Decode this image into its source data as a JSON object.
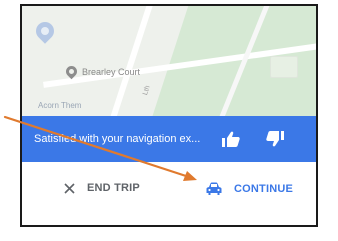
{
  "map": {
    "place_label": "Brearley Court",
    "street_label_1": "Acorn Them",
    "street_label_2": "Lth"
  },
  "feedback_banner": {
    "text": "Satisfied with your navigation ex...",
    "thumbs_up_icon": "thumbs-up-icon",
    "thumbs_down_icon": "thumbs-down-icon"
  },
  "actions": {
    "end_trip_label": "END TRIP",
    "end_trip_icon": "close-icon",
    "continue_label": "CONTINUE",
    "continue_icon": "car-icon"
  },
  "colors": {
    "accent_blue": "#3b78e7",
    "annotation_arrow": "#e07a2e"
  }
}
